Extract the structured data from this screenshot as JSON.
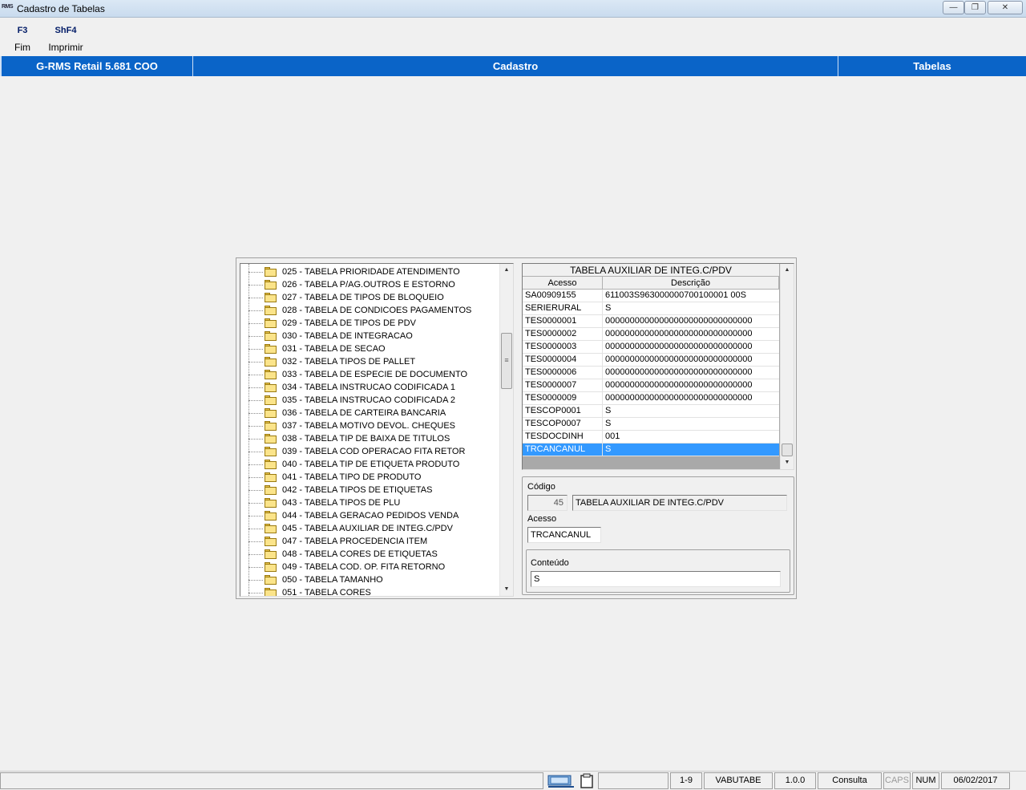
{
  "window": {
    "app_icon": "RMS",
    "title": "Cadastro de Tabelas",
    "minimize_glyph": "—",
    "maximize_glyph": "❐",
    "close_glyph": "✕"
  },
  "toolbar": {
    "f3_key": "F3",
    "f3_label": "Fim",
    "shf4_key": "ShF4",
    "shf4_label": "Imprimir"
  },
  "header": {
    "product": "G-RMS Retail 5.681 COO",
    "module": "Cadastro",
    "screen": "Tabelas"
  },
  "tree": {
    "items": [
      "025 - TABELA PRIORIDADE ATENDIMENTO",
      "026 - TABELA P/AG.OUTROS E ESTORNO",
      "027 - TABELA DE TIPOS DE BLOQUEIO",
      "028 - TABELA DE CONDICOES PAGAMENTOS",
      "029 - TABELA DE TIPOS DE PDV",
      "030 - TABELA DE INTEGRACAO",
      "031 - TABELA DE SECAO",
      "032 - TABELA TIPOS DE PALLET",
      "033 - TABELA DE ESPECIE DE DOCUMENTO",
      "034 - TABELA INSTRUCAO CODIFICADA 1",
      "035 - TABELA INSTRUCAO CODIFICADA 2",
      "036 - TABELA DE CARTEIRA BANCARIA",
      "037 - TABELA MOTIVO DEVOL. CHEQUES",
      "038 - TABELA TIP DE BAIXA DE TITULOS",
      "039 - TABELA COD OPERACAO FITA RETOR",
      "040 - TABELA TIP DE ETIQUETA PRODUTO",
      "041 - TABELA TIPO DE PRODUTO",
      "042 - TABELA TIPOS DE ETIQUETAS",
      "043 - TABELA TIPOS DE PLU",
      "044 - TABELA GERACAO PEDIDOS VENDA",
      "045 - TABELA AUXILIAR DE INTEG.C/PDV",
      "047 - TABELA PROCEDENCIA ITEM",
      "048 - TABELA CORES DE ETIQUETAS",
      "049 - TABELA COD. OP. FITA RETORNO",
      "050 - TABELA TAMANHO",
      "051 - TABELA CORES"
    ]
  },
  "grid": {
    "title": "TABELA AUXILIAR DE INTEG.C/PDV",
    "col_acesso": "Acesso",
    "col_descricao": "Descrição",
    "rows": [
      {
        "acesso": "SA00909155",
        "descricao": "611003S963000000700100001 00S"
      },
      {
        "acesso": "SERIERURAL",
        "descricao": "S"
      },
      {
        "acesso": "TES0000001",
        "descricao": "000000000000000000000000000000"
      },
      {
        "acesso": "TES0000002",
        "descricao": "000000000000000000000000000000"
      },
      {
        "acesso": "TES0000003",
        "descricao": "000000000000000000000000000000"
      },
      {
        "acesso": "TES0000004",
        "descricao": "000000000000000000000000000000"
      },
      {
        "acesso": "TES0000006",
        "descricao": "000000000000000000000000000000"
      },
      {
        "acesso": "TES0000007",
        "descricao": "000000000000000000000000000000"
      },
      {
        "acesso": "TES0000009",
        "descricao": "000000000000000000000000000000"
      },
      {
        "acesso": "TESCOP0001",
        "descricao": "S"
      },
      {
        "acesso": "TESCOP0007",
        "descricao": "S"
      },
      {
        "acesso": "TESDOCDINH",
        "descricao": "001"
      },
      {
        "acesso": "TRCANCANUL",
        "descricao": "S"
      }
    ],
    "selected_index": 12
  },
  "form": {
    "codigo_label": "Código",
    "codigo_value": "45",
    "codigo_desc": "TABELA AUXILIAR DE INTEG.C/PDV",
    "acesso_label": "Acesso",
    "acesso_value": "TRCANCANUL",
    "conteudo_label": "Conteúdo",
    "conteudo_value": "S"
  },
  "statusbar": {
    "range": "1-9",
    "program": "VABUTABE",
    "version": "1.0.0",
    "mode": "Consulta",
    "caps": "CAPS",
    "num": "NUM",
    "date": "06/02/2017"
  },
  "icons": [
    "window-app-icon",
    "folder-icon",
    "network-icon",
    "clipboard-icon",
    "scroll-up-arrow-icon",
    "scroll-down-arrow-icon"
  ],
  "colors": {
    "header_blue": "#0a64c8",
    "selection_blue": "#3399ff",
    "folder_yellow": "#fbe48a"
  }
}
